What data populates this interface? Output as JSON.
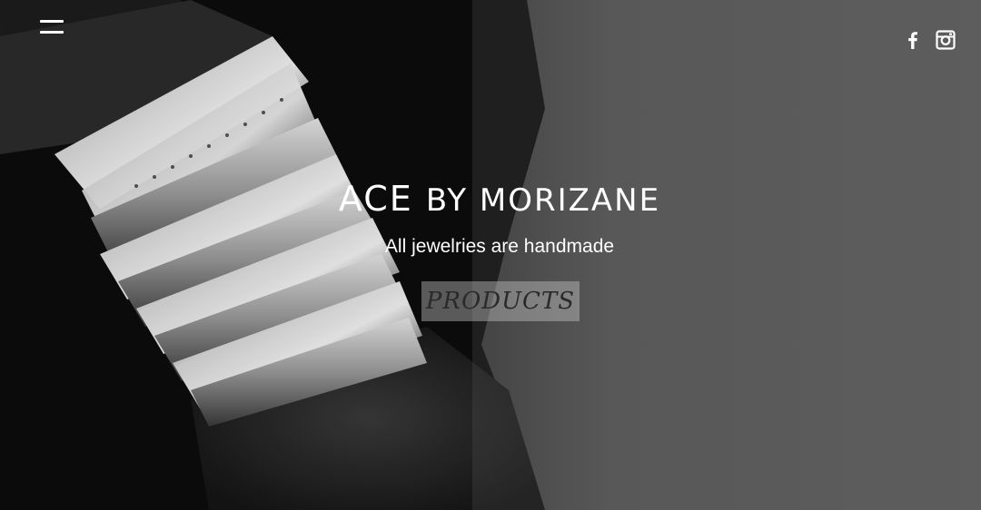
{
  "brand": {
    "title_main": "ACE",
    "title_rest": "by Morizane",
    "tagline": "All jewelries are handmade"
  },
  "cta": {
    "label": "PRODUCTS"
  },
  "header": {
    "menu_icon": "hamburger-menu-icon",
    "social": [
      {
        "icon": "facebook-icon"
      },
      {
        "icon": "instagram-icon"
      }
    ]
  },
  "colors": {
    "text": "#ffffff",
    "button_bg": "#a8a8a8",
    "button_text": "#2a2a2a"
  }
}
